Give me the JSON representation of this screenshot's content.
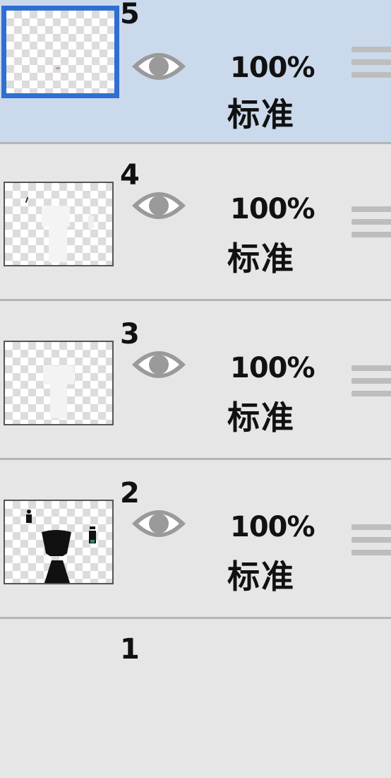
{
  "layers": [
    {
      "number": "5",
      "opacity": "100%",
      "blend_mode": "标准",
      "selected": true
    },
    {
      "number": "4",
      "opacity": "100%",
      "blend_mode": "标准",
      "selected": false
    },
    {
      "number": "3",
      "opacity": "100%",
      "blend_mode": "标准",
      "selected": false
    },
    {
      "number": "2",
      "opacity": "100%",
      "blend_mode": "标准",
      "selected": false
    },
    {
      "number": "1"
    }
  ],
  "colors": {
    "selected_bg": "#cbd9ec",
    "selection_border": "#2f6fd2",
    "row_bg": "#e6e6e6",
    "eye_icon": "#9a9a9a"
  }
}
